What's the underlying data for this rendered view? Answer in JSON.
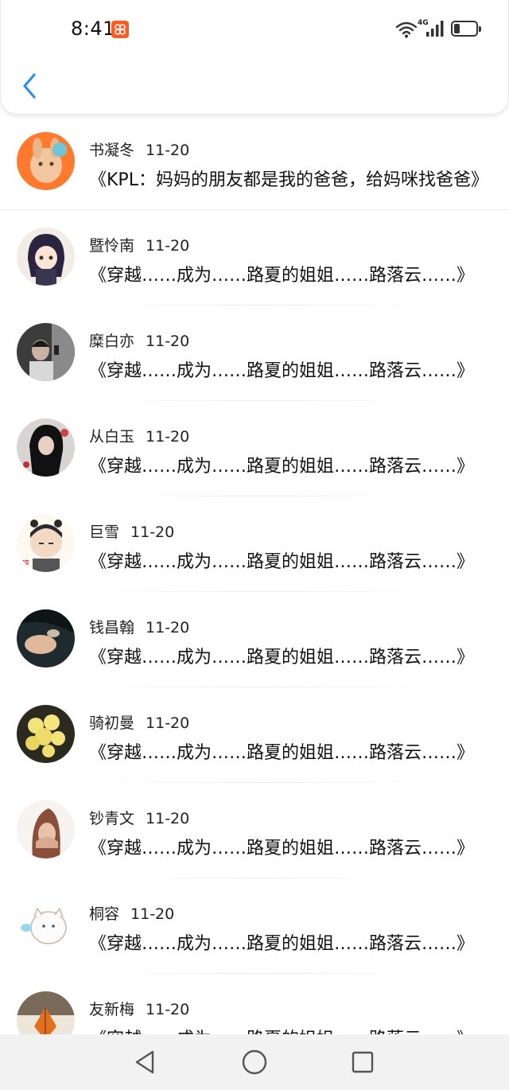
{
  "status_bar": {
    "time": "8:41",
    "network": "4G"
  },
  "header": {
    "back_icon": "chevron-left-icon"
  },
  "colors": {
    "accent": "#2f8ef0",
    "app_badge": "#ff5a1f"
  },
  "messages": [
    {
      "name": "书凝冬",
      "date": "11-20",
      "text": "《KPL：妈妈的朋友都是我的爸爸，给妈咪找爸爸》"
    },
    {
      "name": "暨怜南",
      "date": "11-20",
      "text": "《穿越……成为……路夏的姐姐……路落云……》"
    },
    {
      "name": "糜白亦",
      "date": "11-20",
      "text": "《穿越……成为……路夏的姐姐……路落云……》"
    },
    {
      "name": "从白玉",
      "date": "11-20",
      "text": "《穿越……成为……路夏的姐姐……路落云……》"
    },
    {
      "name": "巨雪",
      "date": "11-20",
      "text": "《穿越……成为……路夏的姐姐……路落云……》"
    },
    {
      "name": "钱昌翰",
      "date": "11-20",
      "text": "《穿越……成为……路夏的姐姐……路落云……》"
    },
    {
      "name": "骑初曼",
      "date": "11-20",
      "text": "《穿越……成为……路夏的姐姐……路落云……》"
    },
    {
      "name": "钞青文",
      "date": "11-20",
      "text": "《穿越……成为……路夏的姐姐……路落云……》"
    },
    {
      "name": "桐容",
      "date": "11-20",
      "text": "《穿越……成为……路夏的姐姐……路落云……》"
    },
    {
      "name": "友新梅",
      "date": "11-20",
      "text": "《穿越……成为……路夏的姐姐……路落云……》"
    }
  ],
  "nav": {
    "back": "triangle-back-icon",
    "home": "circle-home-icon",
    "recents": "square-recents-icon"
  }
}
